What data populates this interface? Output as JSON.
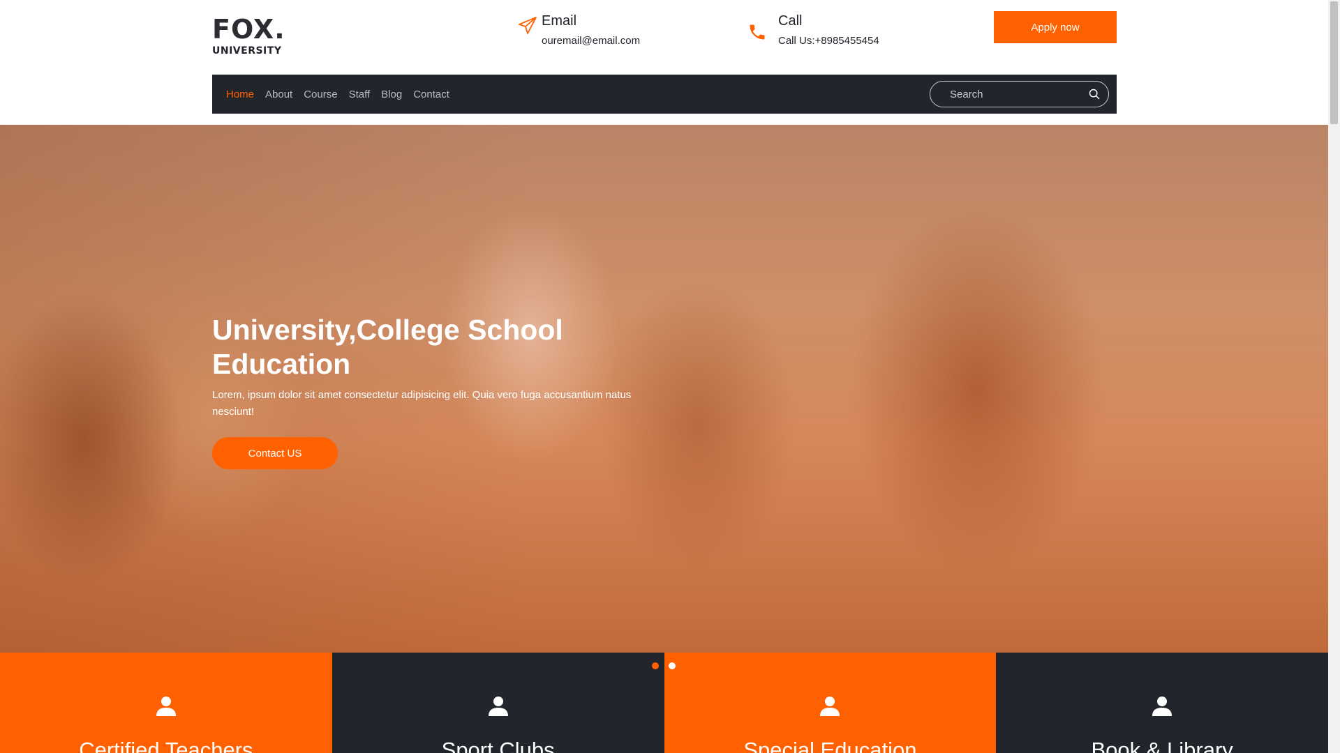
{
  "brand": {
    "name": "FOX.",
    "subtitle": "UNIVERSITY"
  },
  "contact": {
    "email": {
      "title": "Email",
      "value": "ouremail@email.com",
      "icon": "paper-plane-icon"
    },
    "call": {
      "title": "Call",
      "value": "Call Us:+8985455454",
      "icon": "phone-icon"
    }
  },
  "apply_label": "Apply now",
  "nav": {
    "items": [
      {
        "label": "Home",
        "active": true
      },
      {
        "label": "About"
      },
      {
        "label": "Course"
      },
      {
        "label": "Staff"
      },
      {
        "label": "Blog"
      },
      {
        "label": "Contact"
      }
    ],
    "search_placeholder": "Search"
  },
  "hero": {
    "title": "University,College School Education",
    "text": "Lorem, ipsum dolor sit amet consectetur adipisicing elit. Quia vero fuga accusantium natus nesciunt!",
    "button": "Contact US"
  },
  "slider": {
    "dot_count": 2,
    "active_index": 0
  },
  "features": [
    {
      "title": "Certified Teachers",
      "icon": "user-icon",
      "style": "orange"
    },
    {
      "title": "Sport Clubs",
      "icon": "user-icon",
      "style": "dark"
    },
    {
      "title": "Special Education",
      "icon": "user-icon",
      "style": "orange"
    },
    {
      "title": "Book & Library",
      "icon": "user-icon",
      "style": "dark"
    }
  ],
  "colors": {
    "accent": "#ff6000",
    "dark": "#22252b",
    "text": "#1f2228"
  }
}
